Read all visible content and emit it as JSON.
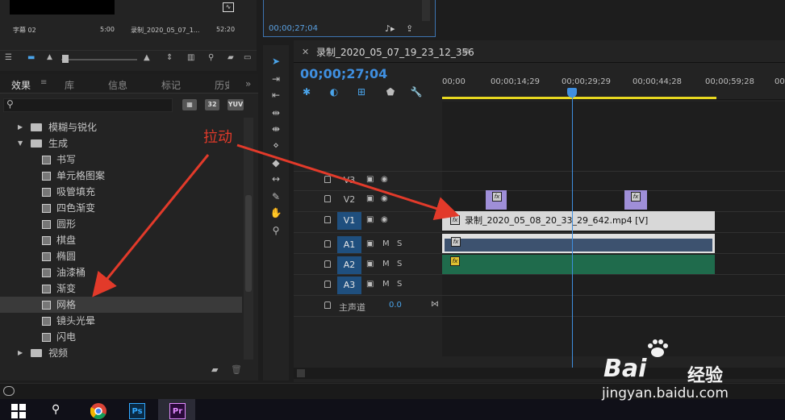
{
  "project_panel": {
    "clip_left_name": "字幕 02",
    "clip_left_duration": "5:00",
    "clip_right_name": "录制_2020_05_07_1...",
    "clip_right_duration": "52:20"
  },
  "program_monitor": {
    "timecode": "00;00;27;04"
  },
  "effects_panel": {
    "tabs": [
      "效果",
      "库",
      "信息",
      "标记",
      "历史"
    ],
    "tab_more": "»",
    "search_placeholder": "",
    "filter_buttons": [
      "32",
      "YUV"
    ],
    "items": [
      {
        "label": "模糊与锐化",
        "kind": "folder",
        "expanded": false
      },
      {
        "label": "生成",
        "kind": "folder",
        "expanded": true
      },
      {
        "label": "书写",
        "kind": "effect"
      },
      {
        "label": "单元格图案",
        "kind": "effect"
      },
      {
        "label": "吸管填充",
        "kind": "effect"
      },
      {
        "label": "四色渐变",
        "kind": "effect"
      },
      {
        "label": "圆形",
        "kind": "effect"
      },
      {
        "label": "棋盘",
        "kind": "effect"
      },
      {
        "label": "椭圆",
        "kind": "effect"
      },
      {
        "label": "油漆桶",
        "kind": "effect"
      },
      {
        "label": "渐变",
        "kind": "effect"
      },
      {
        "label": "网格",
        "kind": "effect",
        "selected": true
      },
      {
        "label": "镜头光晕",
        "kind": "effect"
      },
      {
        "label": "闪电",
        "kind": "effect"
      },
      {
        "label": "视频",
        "kind": "folder",
        "expanded": false
      }
    ]
  },
  "timeline": {
    "sequence_name": "录制_2020_05_07_19_23_12_356",
    "timecode": "00;00;27;04",
    "ruler_ticks": [
      "00;00",
      "00;00;14;29",
      "00;00;29;29",
      "00;00;44;28",
      "00;00;59;28",
      "00;0"
    ],
    "tracks": [
      {
        "name": "V3",
        "type": "video",
        "targeted": false
      },
      {
        "name": "V2",
        "type": "video",
        "targeted": false
      },
      {
        "name": "V1",
        "type": "video",
        "targeted": true
      },
      {
        "name": "A1",
        "type": "audio",
        "targeted": true
      },
      {
        "name": "A2",
        "type": "audio",
        "targeted": true
      },
      {
        "name": "A3",
        "type": "audio",
        "targeted": true
      }
    ],
    "audio_m_label": "M",
    "audio_s_label": "S",
    "master_label": "主声道",
    "master_value": "0.0",
    "clip_v1_name": "录制_2020_05_08_20_33_29_642.mp4 [V]",
    "fx_badge": "fx"
  },
  "annotation": {
    "label": "拉动",
    "color": "#e23a2a"
  },
  "watermark": {
    "brand_latin": "Bai",
    "brand_cn": "经验",
    "url": "jingyan.baidu.com"
  },
  "taskbar": {
    "ps_label": "Ps",
    "pr_label": "Pr"
  },
  "colors": {
    "accent_blue": "#3f8fe0",
    "work_area": "#e8d820",
    "audio_clip_a2": "#1f6b4c",
    "transition": "#9f8fd8"
  }
}
